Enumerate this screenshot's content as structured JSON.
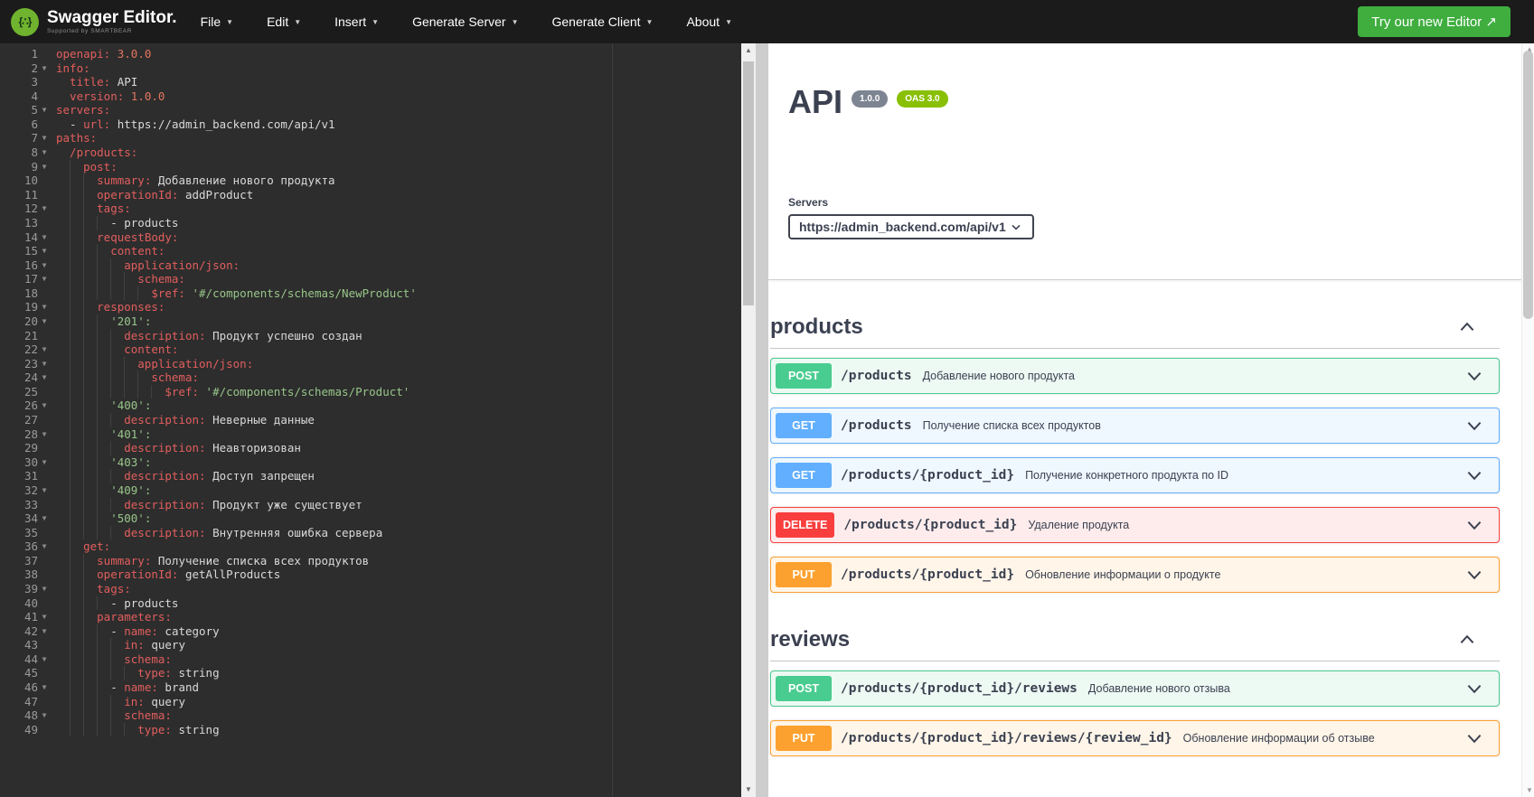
{
  "navbar": {
    "logo_glyph": "{∴}",
    "logo_title": "Swagger Editor.",
    "logo_subtitle": "Supported by SMARTBEAR",
    "menus": [
      {
        "label": "File"
      },
      {
        "label": "Edit"
      },
      {
        "label": "Insert"
      },
      {
        "label": "Generate Server"
      },
      {
        "label": "Generate Client"
      },
      {
        "label": "About"
      }
    ],
    "cta_label": "Try our new Editor",
    "cta_arrow": "↗",
    "colors": {
      "bar": "#1b1b1b",
      "cta_green": "#3fae3f",
      "logo_green": "#6fb32e"
    }
  },
  "editor": {
    "token_colors": {
      "key": "#e35e5e",
      "number": "#e3755e",
      "string": "#97c689",
      "plain": "#d9d9d9"
    },
    "lines": [
      {
        "n": 1,
        "i": 0,
        "f": false,
        "t": [
          [
            "k",
            "openapi:"
          ],
          [
            "n",
            " 3.0.0"
          ]
        ]
      },
      {
        "n": 2,
        "i": 0,
        "f": true,
        "t": [
          [
            "k",
            "info:"
          ]
        ]
      },
      {
        "n": 3,
        "i": 2,
        "f": false,
        "t": [
          [
            "k",
            "title:"
          ],
          [
            "v",
            " API"
          ]
        ]
      },
      {
        "n": 4,
        "i": 2,
        "f": false,
        "t": [
          [
            "k",
            "version:"
          ],
          [
            "n",
            " 1.0.0"
          ]
        ]
      },
      {
        "n": 5,
        "i": 0,
        "f": true,
        "t": [
          [
            "k",
            "servers:"
          ]
        ]
      },
      {
        "n": 6,
        "i": 2,
        "f": false,
        "t": [
          [
            "v",
            "- "
          ],
          [
            "k",
            "url:"
          ],
          [
            "v",
            " https://admin_backend.com/api/v1"
          ]
        ]
      },
      {
        "n": 7,
        "i": 0,
        "f": true,
        "t": [
          [
            "k",
            "paths:"
          ]
        ]
      },
      {
        "n": 8,
        "i": 2,
        "f": true,
        "t": [
          [
            "k",
            "/products:"
          ]
        ]
      },
      {
        "n": 9,
        "i": 4,
        "f": true,
        "t": [
          [
            "k",
            "post:"
          ]
        ]
      },
      {
        "n": 10,
        "i": 6,
        "f": false,
        "t": [
          [
            "k",
            "summary:"
          ],
          [
            "v",
            " Добавление нового продукта"
          ]
        ]
      },
      {
        "n": 11,
        "i": 6,
        "f": false,
        "t": [
          [
            "k",
            "operationId:"
          ],
          [
            "v",
            " addProduct"
          ]
        ]
      },
      {
        "n": 12,
        "i": 6,
        "f": true,
        "t": [
          [
            "k",
            "tags:"
          ]
        ]
      },
      {
        "n": 13,
        "i": 8,
        "f": false,
        "t": [
          [
            "v",
            "- products"
          ]
        ]
      },
      {
        "n": 14,
        "i": 6,
        "f": true,
        "t": [
          [
            "k",
            "requestBody:"
          ]
        ]
      },
      {
        "n": 15,
        "i": 8,
        "f": true,
        "t": [
          [
            "k",
            "content:"
          ]
        ]
      },
      {
        "n": 16,
        "i": 10,
        "f": true,
        "t": [
          [
            "k",
            "application/json:"
          ]
        ]
      },
      {
        "n": 17,
        "i": 12,
        "f": true,
        "t": [
          [
            "k",
            "schema:"
          ]
        ]
      },
      {
        "n": 18,
        "i": 14,
        "f": false,
        "t": [
          [
            "k",
            "$ref:"
          ],
          [
            "s",
            " '#/components/schemas/NewProduct'"
          ]
        ]
      },
      {
        "n": 19,
        "i": 6,
        "f": true,
        "t": [
          [
            "k",
            "responses:"
          ]
        ]
      },
      {
        "n": 20,
        "i": 8,
        "f": true,
        "t": [
          [
            "s",
            "'201':"
          ]
        ]
      },
      {
        "n": 21,
        "i": 10,
        "f": false,
        "t": [
          [
            "k",
            "description:"
          ],
          [
            "v",
            " Продукт успешно создан"
          ]
        ]
      },
      {
        "n": 22,
        "i": 10,
        "f": true,
        "t": [
          [
            "k",
            "content:"
          ]
        ]
      },
      {
        "n": 23,
        "i": 12,
        "f": true,
        "t": [
          [
            "k",
            "application/json:"
          ]
        ]
      },
      {
        "n": 24,
        "i": 14,
        "f": true,
        "t": [
          [
            "k",
            "schema:"
          ]
        ]
      },
      {
        "n": 25,
        "i": 16,
        "f": false,
        "t": [
          [
            "k",
            "$ref:"
          ],
          [
            "s",
            " '#/components/schemas/Product'"
          ]
        ]
      },
      {
        "n": 26,
        "i": 8,
        "f": true,
        "t": [
          [
            "s",
            "'400':"
          ]
        ]
      },
      {
        "n": 27,
        "i": 10,
        "f": false,
        "t": [
          [
            "k",
            "description:"
          ],
          [
            "v",
            " Неверные данные"
          ]
        ]
      },
      {
        "n": 28,
        "i": 8,
        "f": true,
        "t": [
          [
            "s",
            "'401':"
          ]
        ]
      },
      {
        "n": 29,
        "i": 10,
        "f": false,
        "t": [
          [
            "k",
            "description:"
          ],
          [
            "v",
            " Неавторизован"
          ]
        ]
      },
      {
        "n": 30,
        "i": 8,
        "f": true,
        "t": [
          [
            "s",
            "'403':"
          ]
        ]
      },
      {
        "n": 31,
        "i": 10,
        "f": false,
        "t": [
          [
            "k",
            "description:"
          ],
          [
            "v",
            " Доступ запрещен"
          ]
        ]
      },
      {
        "n": 32,
        "i": 8,
        "f": true,
        "t": [
          [
            "s",
            "'409':"
          ]
        ]
      },
      {
        "n": 33,
        "i": 10,
        "f": false,
        "t": [
          [
            "k",
            "description:"
          ],
          [
            "v",
            " Продукт уже существует"
          ]
        ]
      },
      {
        "n": 34,
        "i": 8,
        "f": true,
        "t": [
          [
            "s",
            "'500':"
          ]
        ]
      },
      {
        "n": 35,
        "i": 10,
        "f": false,
        "t": [
          [
            "k",
            "description:"
          ],
          [
            "v",
            " Внутренняя ошибка сервера"
          ]
        ]
      },
      {
        "n": 36,
        "i": 4,
        "f": true,
        "t": [
          [
            "k",
            "get:"
          ]
        ]
      },
      {
        "n": 37,
        "i": 6,
        "f": false,
        "t": [
          [
            "k",
            "summary:"
          ],
          [
            "v",
            " Получение списка всех продуктов"
          ]
        ]
      },
      {
        "n": 38,
        "i": 6,
        "f": false,
        "t": [
          [
            "k",
            "operationId:"
          ],
          [
            "v",
            " getAllProducts"
          ]
        ]
      },
      {
        "n": 39,
        "i": 6,
        "f": true,
        "t": [
          [
            "k",
            "tags:"
          ]
        ]
      },
      {
        "n": 40,
        "i": 8,
        "f": false,
        "t": [
          [
            "v",
            "- products"
          ]
        ]
      },
      {
        "n": 41,
        "i": 6,
        "f": true,
        "t": [
          [
            "k",
            "parameters:"
          ]
        ]
      },
      {
        "n": 42,
        "i": 8,
        "f": true,
        "t": [
          [
            "v",
            "- "
          ],
          [
            "k",
            "name:"
          ],
          [
            "v",
            " category"
          ]
        ]
      },
      {
        "n": 43,
        "i": 10,
        "f": false,
        "t": [
          [
            "k",
            "in:"
          ],
          [
            "v",
            " query"
          ]
        ]
      },
      {
        "n": 44,
        "i": 10,
        "f": true,
        "t": [
          [
            "k",
            "schema:"
          ]
        ]
      },
      {
        "n": 45,
        "i": 12,
        "f": false,
        "t": [
          [
            "k",
            "type:"
          ],
          [
            "v",
            " string"
          ]
        ]
      },
      {
        "n": 46,
        "i": 8,
        "f": true,
        "t": [
          [
            "v",
            "- "
          ],
          [
            "k",
            "name:"
          ],
          [
            "v",
            " brand"
          ]
        ]
      },
      {
        "n": 47,
        "i": 10,
        "f": false,
        "t": [
          [
            "k",
            "in:"
          ],
          [
            "v",
            " query"
          ]
        ]
      },
      {
        "n": 48,
        "i": 10,
        "f": true,
        "t": [
          [
            "k",
            "schema:"
          ]
        ]
      },
      {
        "n": 49,
        "i": 12,
        "f": false,
        "t": [
          [
            "k",
            "type:"
          ],
          [
            "v",
            " string"
          ]
        ]
      }
    ]
  },
  "api_panel": {
    "title": "API",
    "version_badge": "1.0.0",
    "oas_badge": "OAS 3.0",
    "servers_label": "Servers",
    "server_url": "https://admin_backend.com/api/v1",
    "badge_colors": {
      "version_bg": "#7d8492",
      "oas_bg": "#89bf04"
    },
    "method_styles": {
      "POST": {
        "badge": "#49cc90",
        "bg": "#edf9f3",
        "border": "#49cc90"
      },
      "GET": {
        "badge": "#61affe",
        "bg": "#eff7ff",
        "border": "#61affe"
      },
      "DELETE": {
        "badge": "#f93e3e",
        "bg": "#feecec",
        "border": "#f93e3e"
      },
      "PUT": {
        "badge": "#fca130",
        "bg": "#fff5e8",
        "border": "#fca130"
      }
    },
    "sections": [
      {
        "name": "products",
        "collapsed": false,
        "operations": [
          {
            "method": "POST",
            "path": "/products",
            "summary": "Добавление нового продукта"
          },
          {
            "method": "GET",
            "path": "/products",
            "summary": "Получение списка всех продуктов"
          },
          {
            "method": "GET",
            "path": "/products/{product_id}",
            "summary": "Получение конкретного продукта по ID"
          },
          {
            "method": "DELETE",
            "path": "/products/{product_id}",
            "summary": "Удаление продукта"
          },
          {
            "method": "PUT",
            "path": "/products/{product_id}",
            "summary": "Обновление информации о продукте"
          }
        ]
      },
      {
        "name": "reviews",
        "collapsed": false,
        "operations": [
          {
            "method": "POST",
            "path": "/products/{product_id}/reviews",
            "summary": "Добавление нового отзыва"
          },
          {
            "method": "PUT",
            "path": "/products/{product_id}/reviews/{review_id}",
            "summary": "Обновление информации об отзыве"
          }
        ]
      }
    ]
  }
}
